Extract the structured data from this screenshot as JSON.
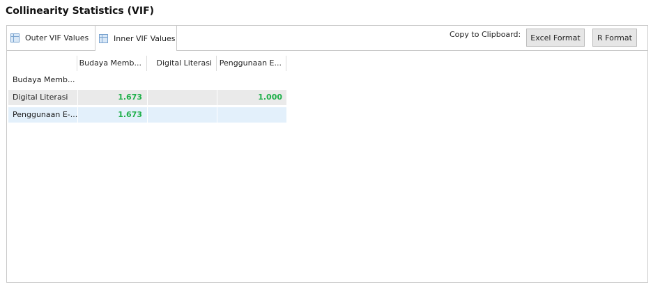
{
  "title": "Collinearity Statistics (VIF)",
  "tabs": [
    {
      "label": "Outer VIF Values",
      "icon": "table-icon",
      "active": false
    },
    {
      "label": "Inner VIF Values",
      "icon": "table-icon",
      "active": true
    }
  ],
  "clipboard": {
    "label": "Copy to Clipboard:",
    "excel_label": "Excel Format",
    "r_label": "R Format"
  },
  "colors": {
    "value_text": "#20b04b",
    "selected_row": "#e3f0fb",
    "alt_row": "#eaeaea"
  },
  "table": {
    "columns": [
      "",
      "Budaya Memb...",
      "Digital Literasi",
      "Penggunaan E..."
    ],
    "rows": [
      [
        "Budaya Memb...",
        "",
        "",
        ""
      ],
      [
        "Digital Literasi",
        "1.673",
        "",
        "1.000"
      ],
      [
        "Penggunaan E-...",
        "1.673",
        "",
        ""
      ]
    ]
  }
}
